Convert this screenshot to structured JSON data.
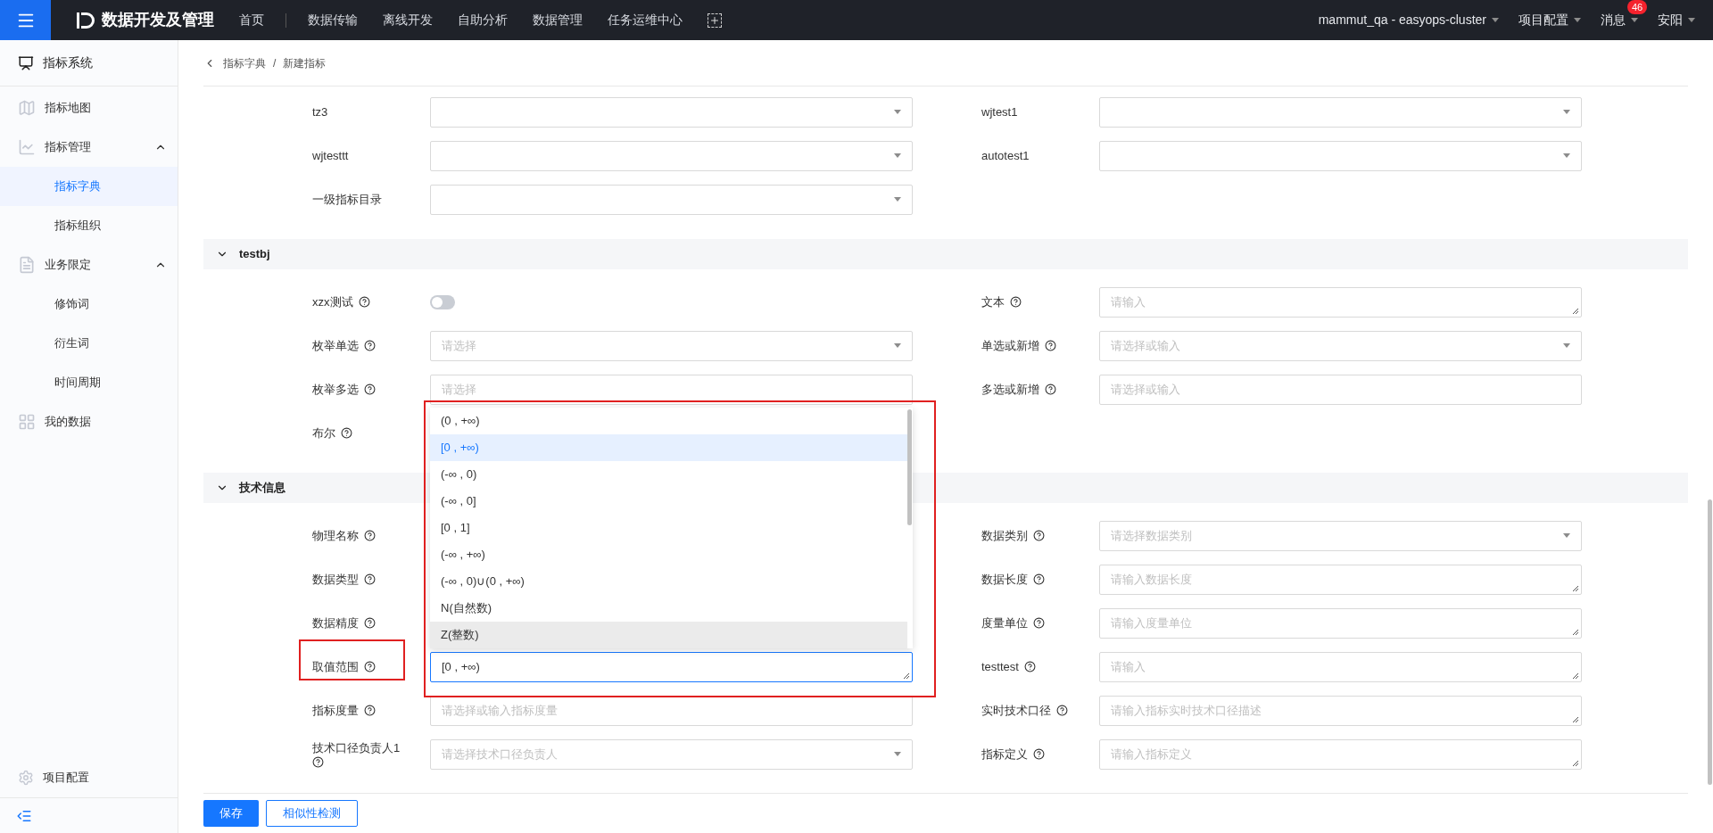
{
  "top_bar": {
    "app_title": "数据开发及管理",
    "nav": [
      {
        "label": "首页",
        "selected": false
      },
      {
        "label": "数据传输",
        "selected": false
      },
      {
        "label": "离线开发",
        "selected": false
      },
      {
        "label": "自助分析",
        "selected": false
      },
      {
        "label": "数据管理",
        "selected": false
      },
      {
        "label": "任务运维中心",
        "selected": false
      }
    ],
    "menus": [
      {
        "label": "mammut_qa - easyops-cluster"
      },
      {
        "label": "项目配置"
      },
      {
        "label": "消息",
        "badge": "46"
      },
      {
        "label": "安阳"
      }
    ]
  },
  "sidebar": {
    "title": "指标系统",
    "items": [
      {
        "label": "指标地图",
        "kind": "map"
      },
      {
        "label": "指标管理",
        "kind": "chart",
        "expanded": true,
        "children": [
          {
            "label": "指标字典",
            "selected": true
          },
          {
            "label": "指标组织",
            "selected": false
          }
        ]
      },
      {
        "label": "业务限定",
        "kind": "doc",
        "expanded": true,
        "children": [
          {
            "label": "修饰词",
            "selected": false
          },
          {
            "label": "衍生词",
            "selected": false
          },
          {
            "label": "时间周期",
            "selected": false
          }
        ]
      },
      {
        "label": "我的数据",
        "kind": "grid"
      }
    ],
    "footer": "项目配置"
  },
  "breadcrumb": {
    "items": [
      "指标字典",
      "新建指标"
    ],
    "separator": "/"
  },
  "groups": [
    {
      "rows": [
        {
          "left": {
            "label": "tz3",
            "kind": "select"
          },
          "right": {
            "label": "wjtest1",
            "kind": "select"
          }
        },
        {
          "left": {
            "label": "wjtesttt",
            "kind": "select"
          },
          "right": {
            "label": "autotest1",
            "kind": "select"
          }
        },
        {
          "left": {
            "label": "一级指标目录",
            "kind": "select"
          }
        }
      ]
    },
    {
      "title": "testbj",
      "expanded": true,
      "rows": [
        {
          "left": {
            "label": "xzx测试",
            "help": true,
            "kind": "switch",
            "on": false
          },
          "right": {
            "label": "文本",
            "help": true,
            "kind": "textarea",
            "placeholder": "请输入"
          }
        },
        {
          "left": {
            "label": "枚举单选",
            "help": true,
            "kind": "select",
            "placeholder": "请选择"
          },
          "right": {
            "label": "单选或新增",
            "help": true,
            "kind": "select",
            "placeholder": "请选择或输入"
          }
        },
        {
          "left": {
            "label": "枚举多选",
            "help": true,
            "kind": "input",
            "placeholder": "请选择"
          },
          "right": {
            "label": "多选或新增",
            "help": true,
            "kind": "input",
            "placeholder": "请选择或输入"
          }
        },
        {
          "left": {
            "label": "布尔",
            "help": true
          }
        }
      ]
    },
    {
      "title": "技术信息",
      "expanded": true,
      "rows": [
        {
          "left": {
            "label": "物理名称",
            "help": true
          },
          "right": {
            "label": "数据类别",
            "help": true,
            "kind": "select",
            "placeholder": "请选择数据类别"
          }
        },
        {
          "left": {
            "label": "数据类型",
            "help": true
          },
          "right": {
            "label": "数据长度",
            "help": true,
            "kind": "textarea",
            "placeholder": "请输入数据长度"
          }
        },
        {
          "left": {
            "label": "数据精度",
            "help": true
          },
          "right": {
            "label": "度量单位",
            "help": true,
            "kind": "textarea",
            "placeholder": "请输入度量单位"
          }
        },
        {
          "left": {
            "label": "取值范围",
            "help": true,
            "kind": "textarea",
            "value": "[0 , +∞)",
            "focused": true,
            "highlighted": true,
            "options": [
              {
                "label": "(0 , +∞)",
                "selected": false,
                "hovered": false
              },
              {
                "label": "[0 , +∞)",
                "selected": true,
                "hovered": false
              },
              {
                "label": "(-∞ , 0)",
                "selected": false,
                "hovered": false
              },
              {
                "label": "(-∞ , 0]",
                "selected": false,
                "hovered": false
              },
              {
                "label": "[0 , 1]",
                "selected": false,
                "hovered": false
              },
              {
                "label": "(-∞ ,  +∞)",
                "selected": false,
                "hovered": false
              },
              {
                "label": "(-∞ , 0)∪(0 , +∞)",
                "selected": false,
                "hovered": false
              },
              {
                "label": "N(自然数)",
                "selected": false,
                "hovered": false
              },
              {
                "label": "Z(整数)",
                "selected": false,
                "hovered": true
              }
            ]
          },
          "right": {
            "label": "testtest",
            "help": true,
            "kind": "textarea",
            "placeholder": "请输入"
          }
        },
        {
          "left": {
            "label": "指标度量",
            "help": true,
            "kind": "input",
            "placeholder": "请选择或输入指标度量"
          },
          "right": {
            "label": "实时技术口径",
            "help": true,
            "kind": "textarea",
            "placeholder": "请输入指标实时技术口径描述"
          }
        },
        {
          "left": {
            "label": "技术口径负责人1",
            "help": true,
            "kind": "select",
            "placeholder": "请选择技术口径负责人"
          },
          "right": {
            "label": "指标定义",
            "help": true,
            "kind": "textarea",
            "placeholder": "请输入指标定义"
          }
        }
      ]
    }
  ],
  "actions": [
    {
      "label": "保存",
      "kind": "primary"
    },
    {
      "label": "相似性检测",
      "kind": "outline"
    }
  ]
}
